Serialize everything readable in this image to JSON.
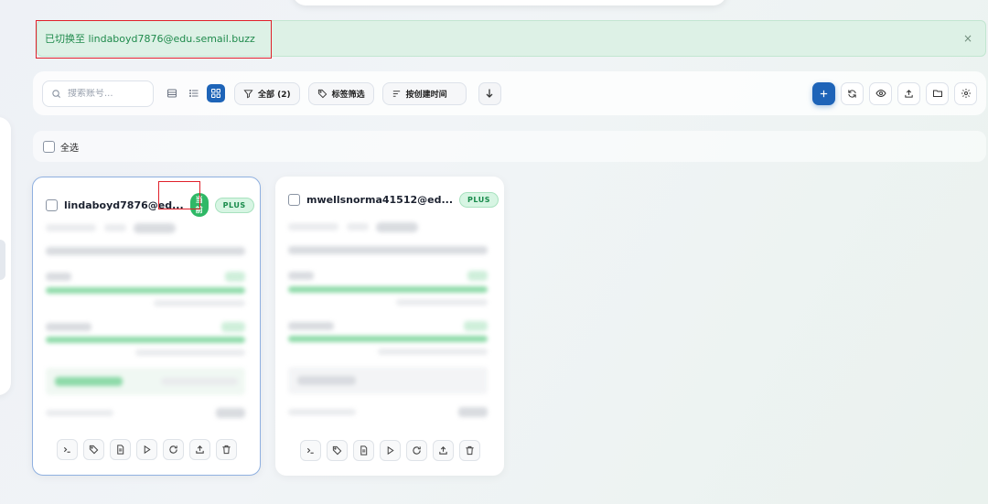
{
  "toast": {
    "message": "已切换至 lindaboyd7876@edu.semail.buzz",
    "close": "×"
  },
  "toolbar": {
    "search_placeholder": "搜索账号...",
    "filter_all": "全部 (2)",
    "tag_filter": "标签筛选",
    "sort_label": "按创建时间",
    "active_view": "grid"
  },
  "select_all": {
    "label": "全选"
  },
  "accounts": [
    {
      "email": "lindaboyd7876@ed...",
      "current_badge": "当前",
      "plan": "PLUS"
    },
    {
      "email": "mwellsnorma41512@ed...",
      "plan": "PLUS"
    }
  ],
  "colors": {
    "accent": "#1e64b8",
    "success": "#2fb866",
    "toast_bg": "#ddf1e6"
  }
}
